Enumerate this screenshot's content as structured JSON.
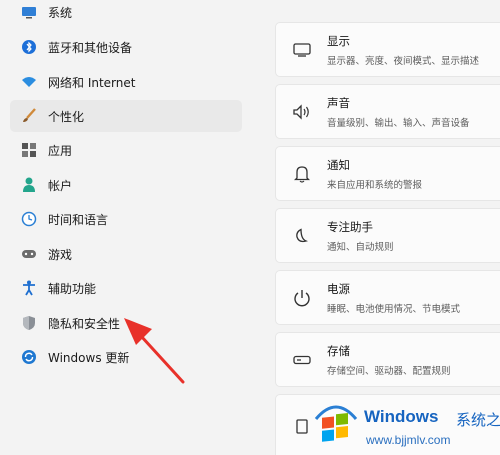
{
  "sidebar": {
    "items": [
      {
        "label": "系统",
        "icon": "monitor-icon"
      },
      {
        "label": "蓝牙和其他设备",
        "icon": "bluetooth-icon"
      },
      {
        "label": "网络和 Internet",
        "icon": "wifi-icon"
      },
      {
        "label": "个性化",
        "icon": "brush-icon",
        "active": true
      },
      {
        "label": "应用",
        "icon": "apps-icon"
      },
      {
        "label": "帐户",
        "icon": "person-icon"
      },
      {
        "label": "时间和语言",
        "icon": "globe-clock-icon"
      },
      {
        "label": "游戏",
        "icon": "gamepad-icon"
      },
      {
        "label": "辅助功能",
        "icon": "accessibility-icon"
      },
      {
        "label": "隐私和安全性",
        "icon": "shield-icon"
      },
      {
        "label": "Windows 更新",
        "icon": "update-icon"
      }
    ]
  },
  "cards": [
    {
      "title": "显示",
      "subtitle": "显示器、亮度、夜间模式、显示描述",
      "icon": "display-icon"
    },
    {
      "title": "声音",
      "subtitle": "音量级别、输出、输入、声音设备",
      "icon": "speaker-icon"
    },
    {
      "title": "通知",
      "subtitle": "来自应用和系统的警报",
      "icon": "bell-icon"
    },
    {
      "title": "专注助手",
      "subtitle": "通知、自动规则",
      "icon": "moon-icon"
    },
    {
      "title": "电源",
      "subtitle": "睡眠、电池使用情况、节电模式",
      "icon": "power-icon"
    },
    {
      "title": "存储",
      "subtitle": "存储空间、驱动器、配置规则",
      "icon": "storage-icon"
    }
  ],
  "watermark": {
    "brand": "Windows",
    "cn": "系统之家",
    "url": "www.bjjmlv.com"
  },
  "colors": {
    "accent": "#0067c0",
    "arrow": "#e8312a",
    "watermark": "#1664c0"
  }
}
